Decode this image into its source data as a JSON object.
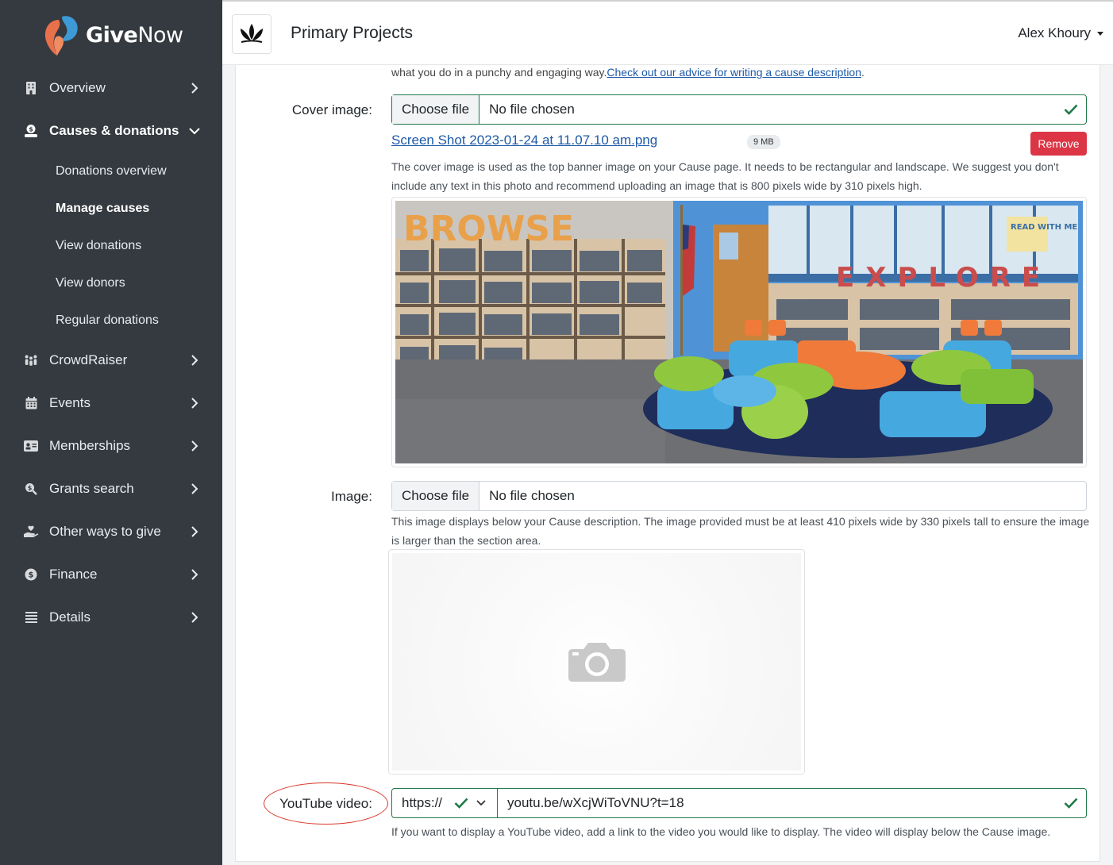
{
  "brand": {
    "logo_text_bold": "Give",
    "logo_text_light": "Now"
  },
  "sidebar": {
    "items": [
      {
        "label": "Overview",
        "icon": "building-icon",
        "chevron": "right"
      },
      {
        "label": "Causes & donations",
        "icon": "donation-icon",
        "chevron": "down",
        "active": true,
        "children": [
          {
            "label": "Donations overview"
          },
          {
            "label": "Manage causes",
            "active": true
          },
          {
            "label": "View donations"
          },
          {
            "label": "View donors"
          },
          {
            "label": "Regular donations"
          }
        ]
      },
      {
        "label": "CrowdRaiser",
        "icon": "people-icon",
        "chevron": "right"
      },
      {
        "label": "Events",
        "icon": "calendar-icon",
        "chevron": "right"
      },
      {
        "label": "Memberships",
        "icon": "id-card-icon",
        "chevron": "right"
      },
      {
        "label": "Grants search",
        "icon": "search-dollar-icon",
        "chevron": "right"
      },
      {
        "label": "Other ways to give",
        "icon": "hand-heart-icon",
        "chevron": "right"
      },
      {
        "label": "Finance",
        "icon": "dollar-icon",
        "chevron": "right"
      },
      {
        "label": "Details",
        "icon": "list-icon",
        "chevron": "right"
      }
    ]
  },
  "header": {
    "org_name": "Primary Projects",
    "user_name": "Alex Khoury"
  },
  "form": {
    "desc_top_text": "what you do in a punchy and engaging way.",
    "desc_top_link": "Check out our advice for writing a cause description",
    "desc_top_end": ".",
    "cover": {
      "label": "Cover image:",
      "button": "Choose file",
      "status": "No file chosen",
      "file_name": "Screen Shot 2023-01-24 at 11.07.10 am.png",
      "file_size": "9 MB",
      "remove": "Remove",
      "help": "The cover image is used as the top banner image on your Cause page. It needs to be rectangular and landscape. We suggest you don't include any text in this photo and recommend uploading an image that is 800 pixels wide by 310 pixels high.",
      "photo_letters_wall": "EXPLORE",
      "photo_letters_shelf": "BROWSE",
      "photo_sign": "READ WITH ME"
    },
    "image": {
      "label": "Image:",
      "button": "Choose file",
      "status": "No file chosen",
      "help": "This image displays below your Cause description. The image provided must be at least 410 pixels wide by 330 pixels tall to ensure the image is larger than the section area."
    },
    "youtube": {
      "label": "YouTube video:",
      "protocol": "https://",
      "value": "youtu.be/wXcjWiToVNU?t=18",
      "help": "If you want to display a YouTube video, add a link to the video you would like to display. The video will display below the Cause image."
    }
  },
  "colors": {
    "sidebar_bg": "#353a40",
    "valid_green": "#1f7a4a",
    "danger": "#dc3545",
    "link": "#1d5aa8",
    "annotation_red": "#d9372c"
  }
}
